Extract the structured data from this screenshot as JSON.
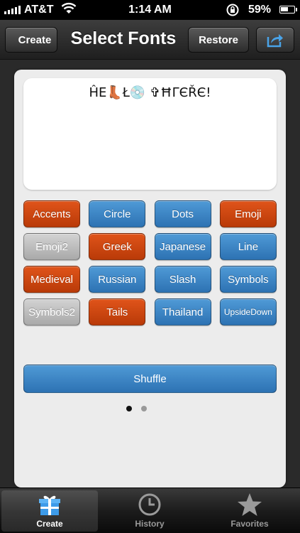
{
  "status_bar": {
    "carrier": "AT&T",
    "time": "1:14 AM",
    "battery": "59%",
    "battery_level": 0.59,
    "icons": [
      "signal-icon",
      "wifi-icon",
      "rotation-lock-icon",
      "battery-icon"
    ]
  },
  "nav": {
    "back_label": "Create",
    "title": "Select Fonts",
    "restore_label": "Restore",
    "share_icon": "share-icon"
  },
  "preview": {
    "text": "ĤE👢Ł💿 ✞ĦΓЄŘЄ!"
  },
  "fonts": [
    {
      "label": "Accents",
      "style": "orange"
    },
    {
      "label": "Circle",
      "style": "blue"
    },
    {
      "label": "Dots",
      "style": "blue"
    },
    {
      "label": "Emoji",
      "style": "orange"
    },
    {
      "label": "Emoji2",
      "style": "gray"
    },
    {
      "label": "Greek",
      "style": "orange"
    },
    {
      "label": "Japanese",
      "style": "blue"
    },
    {
      "label": "Line",
      "style": "blue"
    },
    {
      "label": "Medieval",
      "style": "orange"
    },
    {
      "label": "Russian",
      "style": "blue"
    },
    {
      "label": "Slash",
      "style": "blue"
    },
    {
      "label": "Symbols",
      "style": "blue"
    },
    {
      "label": "Symbols2",
      "style": "gray"
    },
    {
      "label": "Tails",
      "style": "orange"
    },
    {
      "label": "Thailand",
      "style": "blue"
    },
    {
      "label": "UpsideDown",
      "style": "blue"
    }
  ],
  "pager": {
    "pages": 2,
    "current": 1
  },
  "shuffle_label": "Shuffle",
  "tabs": [
    {
      "label": "Create",
      "icon": "gift-icon",
      "active": true
    },
    {
      "label": "History",
      "icon": "clock-icon",
      "active": false
    },
    {
      "label": "Favorites",
      "icon": "star-icon",
      "active": false
    }
  ],
  "colors": {
    "orange": "#d04a12",
    "blue": "#3d86c6",
    "gray": "#bdbdbd"
  }
}
